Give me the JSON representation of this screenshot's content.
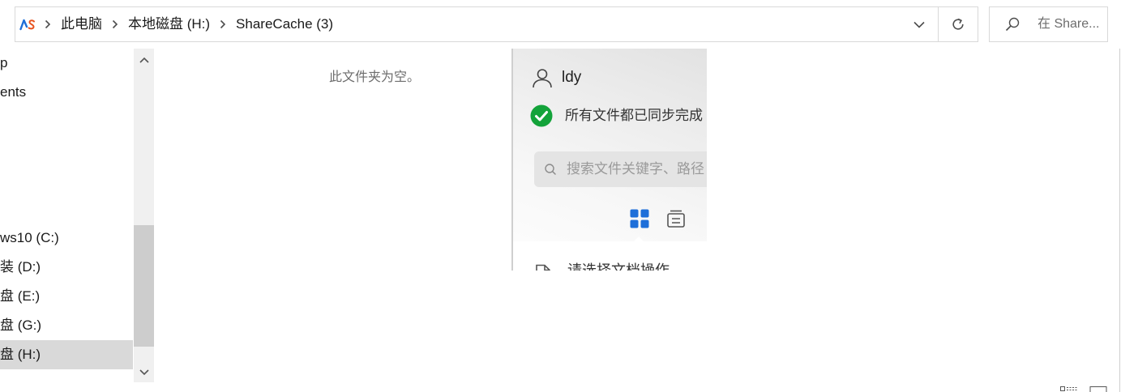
{
  "colors": {
    "accent": "#1e6fd9",
    "success": "#13a33a",
    "selection": "#d9d9d9",
    "text": "#1a1a1a",
    "muted": "#6d6d6d",
    "border": "#d9d9d9",
    "brand-secondary": "#e8531f"
  },
  "address_bar": {
    "location_icon": "app-logo-icon",
    "separator_icon": "chevron-right-icon",
    "crumbs": [
      "此电脑",
      "本地磁盘 (H:)",
      "ShareCache (3)"
    ],
    "history_dropdown_icon": "chevron-down-icon"
  },
  "refresh_button": {
    "icon": "refresh-icon"
  },
  "search": {
    "icon": "search-icon",
    "placeholder": "在 Share..."
  },
  "nav_pane": {
    "quick_access": [
      {
        "label": "p"
      },
      {
        "label": "ents"
      }
    ],
    "drives": [
      {
        "label": "ws10 (C:)",
        "selected": false
      },
      {
        "label": "装 (D:)",
        "selected": false
      },
      {
        "label": "盘 (E:)",
        "selected": false
      },
      {
        "label": "盘 (G:)",
        "selected": false
      },
      {
        "label": "盘 (H:)",
        "selected": true
      }
    ],
    "scrollbar": {
      "up_icon": "chevron-up-icon",
      "down_icon": "chevron-down-icon"
    }
  },
  "file_list": {
    "empty_message": "此文件夹为空。"
  },
  "sync_panel": {
    "user_icon": "user-icon",
    "username": "ldy",
    "status_icon": "check-circle-icon",
    "status_text": "所有文件都已同步完成",
    "search_icon": "search-icon",
    "search_placeholder": "搜索文件关键字、路径",
    "view_tabs": [
      {
        "icon": "grid-icon",
        "active": true
      },
      {
        "icon": "archive-list-icon",
        "active": false
      }
    ],
    "hint_icon": "file-icon",
    "hint_text": "请选择文档操作"
  },
  "status_bar": {
    "view_buttons": [
      {
        "icon": "details-view-icon"
      },
      {
        "icon": "large-icons-view-icon"
      }
    ]
  }
}
